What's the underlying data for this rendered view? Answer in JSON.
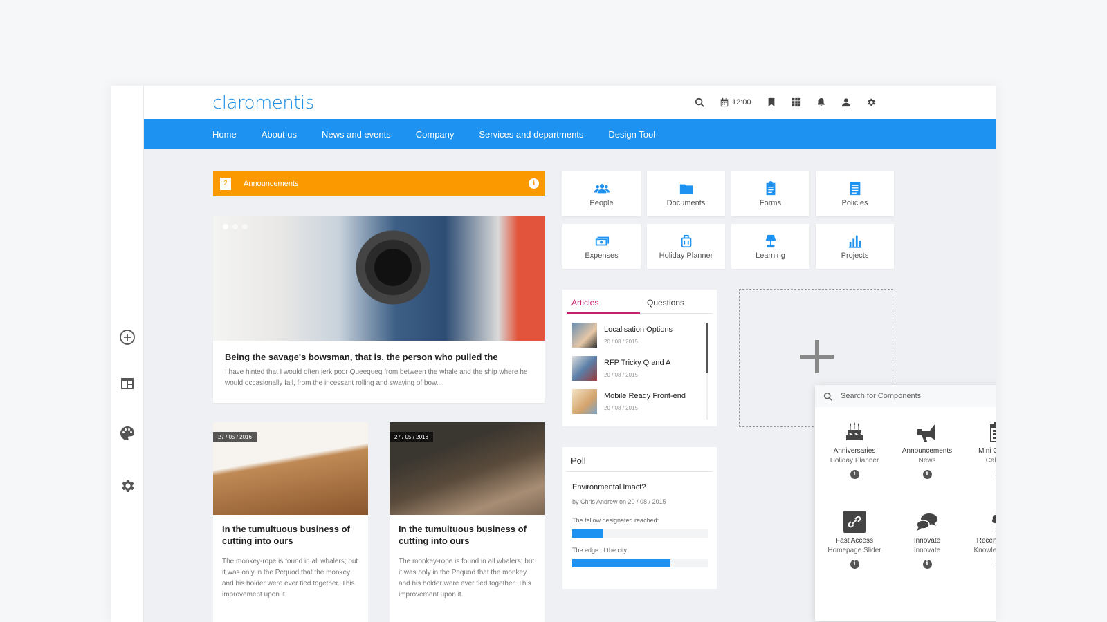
{
  "brand": {
    "logo_text": "claromentis",
    "accent": "#1e92f0",
    "announcement_color": "#fb9900",
    "tab_color": "#c81d6c"
  },
  "topbar": {
    "icons": [
      "search-icon",
      "calendar-icon",
      "bookmark-icon",
      "apps-grid-icon",
      "bell-icon",
      "user-icon",
      "gear-icon"
    ],
    "time": "12:00"
  },
  "nav": {
    "items": [
      {
        "label": "Home"
      },
      {
        "label": "About us"
      },
      {
        "label": "News and events"
      },
      {
        "label": "Company"
      },
      {
        "label": "Services and departments"
      },
      {
        "label": "Design Tool"
      }
    ]
  },
  "sidebar": {
    "icons": [
      "add-circle-icon",
      "layout-icon",
      "palette-icon",
      "gear-icon"
    ]
  },
  "announcements": {
    "count": "2",
    "label": "Announcements",
    "info": "i"
  },
  "hero": {
    "title": "Being the savage's bowsman, that is, the person who pulled the",
    "text": "I have hinted that I would often jerk poor Queequeg from between the whale and the ship where he would occasionally fall, from the incessant rolling and swaying of bow..."
  },
  "cards": [
    {
      "date": "27 / 05 / 2016",
      "title": "In the tumultuous business of cutting into ours",
      "text": "The monkey-rope is found in all whalers; but it was only in the Pequod that the monkey and his holder were ever tied together. This improvement upon it."
    },
    {
      "date": "27 / 05 / 2016",
      "title": "In the tumultuous business of cutting into ours",
      "text": "The monkey-rope is found in all whalers; but it was only in the Pequod that the monkey and his holder were ever tied together. This improvement upon it."
    }
  ],
  "quick_links": [
    {
      "label": "People",
      "icon": "people-icon"
    },
    {
      "label": "Documents",
      "icon": "folder-icon"
    },
    {
      "label": "Forms",
      "icon": "clipboard-icon"
    },
    {
      "label": "Policies",
      "icon": "document-icon"
    },
    {
      "label": "Expenses",
      "icon": "money-icon"
    },
    {
      "label": "Holiday Planner",
      "icon": "luggage-icon"
    },
    {
      "label": "Learning",
      "icon": "lamp-icon"
    },
    {
      "label": "Projects",
      "icon": "bar-chart-icon"
    }
  ],
  "articles_panel": {
    "tabs": [
      "Articles",
      "Questions"
    ],
    "items": [
      {
        "title": "Localisation Options",
        "date": "20 / 08 / 2015"
      },
      {
        "title": "RFP Tricky Q and A",
        "date": "20 / 08 / 2015"
      },
      {
        "title": "Mobile Ready Front-end",
        "date": "20 / 08 / 2015"
      }
    ]
  },
  "poll": {
    "title": "Poll",
    "question": "Environmental Imact?",
    "byline": "by Chris Andrew on 20 / 08 / 2015",
    "options": [
      {
        "label": "The fellow designated reached:",
        "fraction": 0.23
      },
      {
        "label": "The edge of the city:",
        "fraction": 0.72
      }
    ]
  },
  "component_picker": {
    "search_placeholder": "Search for Components",
    "components": [
      {
        "name": "Anniversaries",
        "category": "Holiday Planner",
        "icon": "cake-icon"
      },
      {
        "name": "Announcements",
        "category": "News",
        "icon": "megaphone-icon"
      },
      {
        "name": "Mini Calendar",
        "category": "Calendar",
        "icon": "calendar-icon"
      },
      {
        "name": "Fast Access",
        "category": "Homepage Slider",
        "icon": "link-icon"
      },
      {
        "name": "Innovate",
        "category": "Innovate",
        "icon": "chat-bubbles-icon"
      },
      {
        "name": "Recent Articles",
        "category": "Knowledge Base",
        "icon": "tree-icon"
      }
    ],
    "info_glyph": "i"
  }
}
